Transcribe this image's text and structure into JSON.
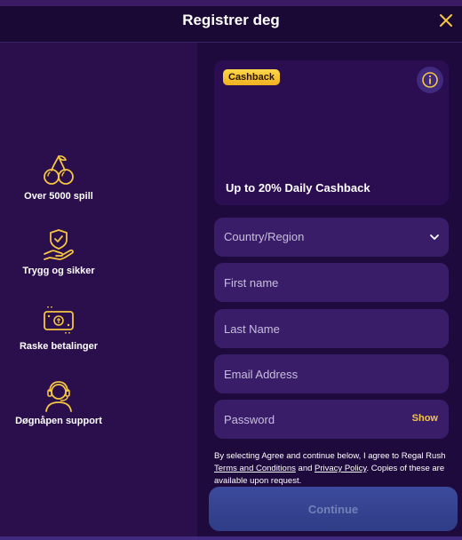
{
  "header": {
    "title": "Registrer deg"
  },
  "features": [
    {
      "label": "Over 5000 spill",
      "icon": "cherries-icon"
    },
    {
      "label": "Trygg og sikker",
      "icon": "shield-hand-icon"
    },
    {
      "label": "Raske betalinger",
      "icon": "banknote-icon"
    },
    {
      "label": "Døgnåpen support",
      "icon": "headset-support-icon"
    }
  ],
  "promo": {
    "badge": "Cashback",
    "text": "Up to 20% Daily Cashback"
  },
  "form": {
    "country_label": "Country/Region",
    "first_name_placeholder": "First name",
    "last_name_placeholder": "Last Name",
    "email_placeholder": "Email Address",
    "password_placeholder": "Password",
    "show_label": "Show"
  },
  "terms": {
    "part1": "By selecting Agree and continue below, I agree to Regal Rush ",
    "terms_link": "Terms and Conditions",
    "and": " and ",
    "privacy_link": "Privacy Policy",
    "part2": ". Copies of these are available upon request."
  },
  "continue_label": "Continue",
  "colors": {
    "accent": "#f5c542",
    "background": "#2a0f4c",
    "panel": "#1f0a3d",
    "field": "#3a1d68",
    "button": "#3b4a9c"
  }
}
